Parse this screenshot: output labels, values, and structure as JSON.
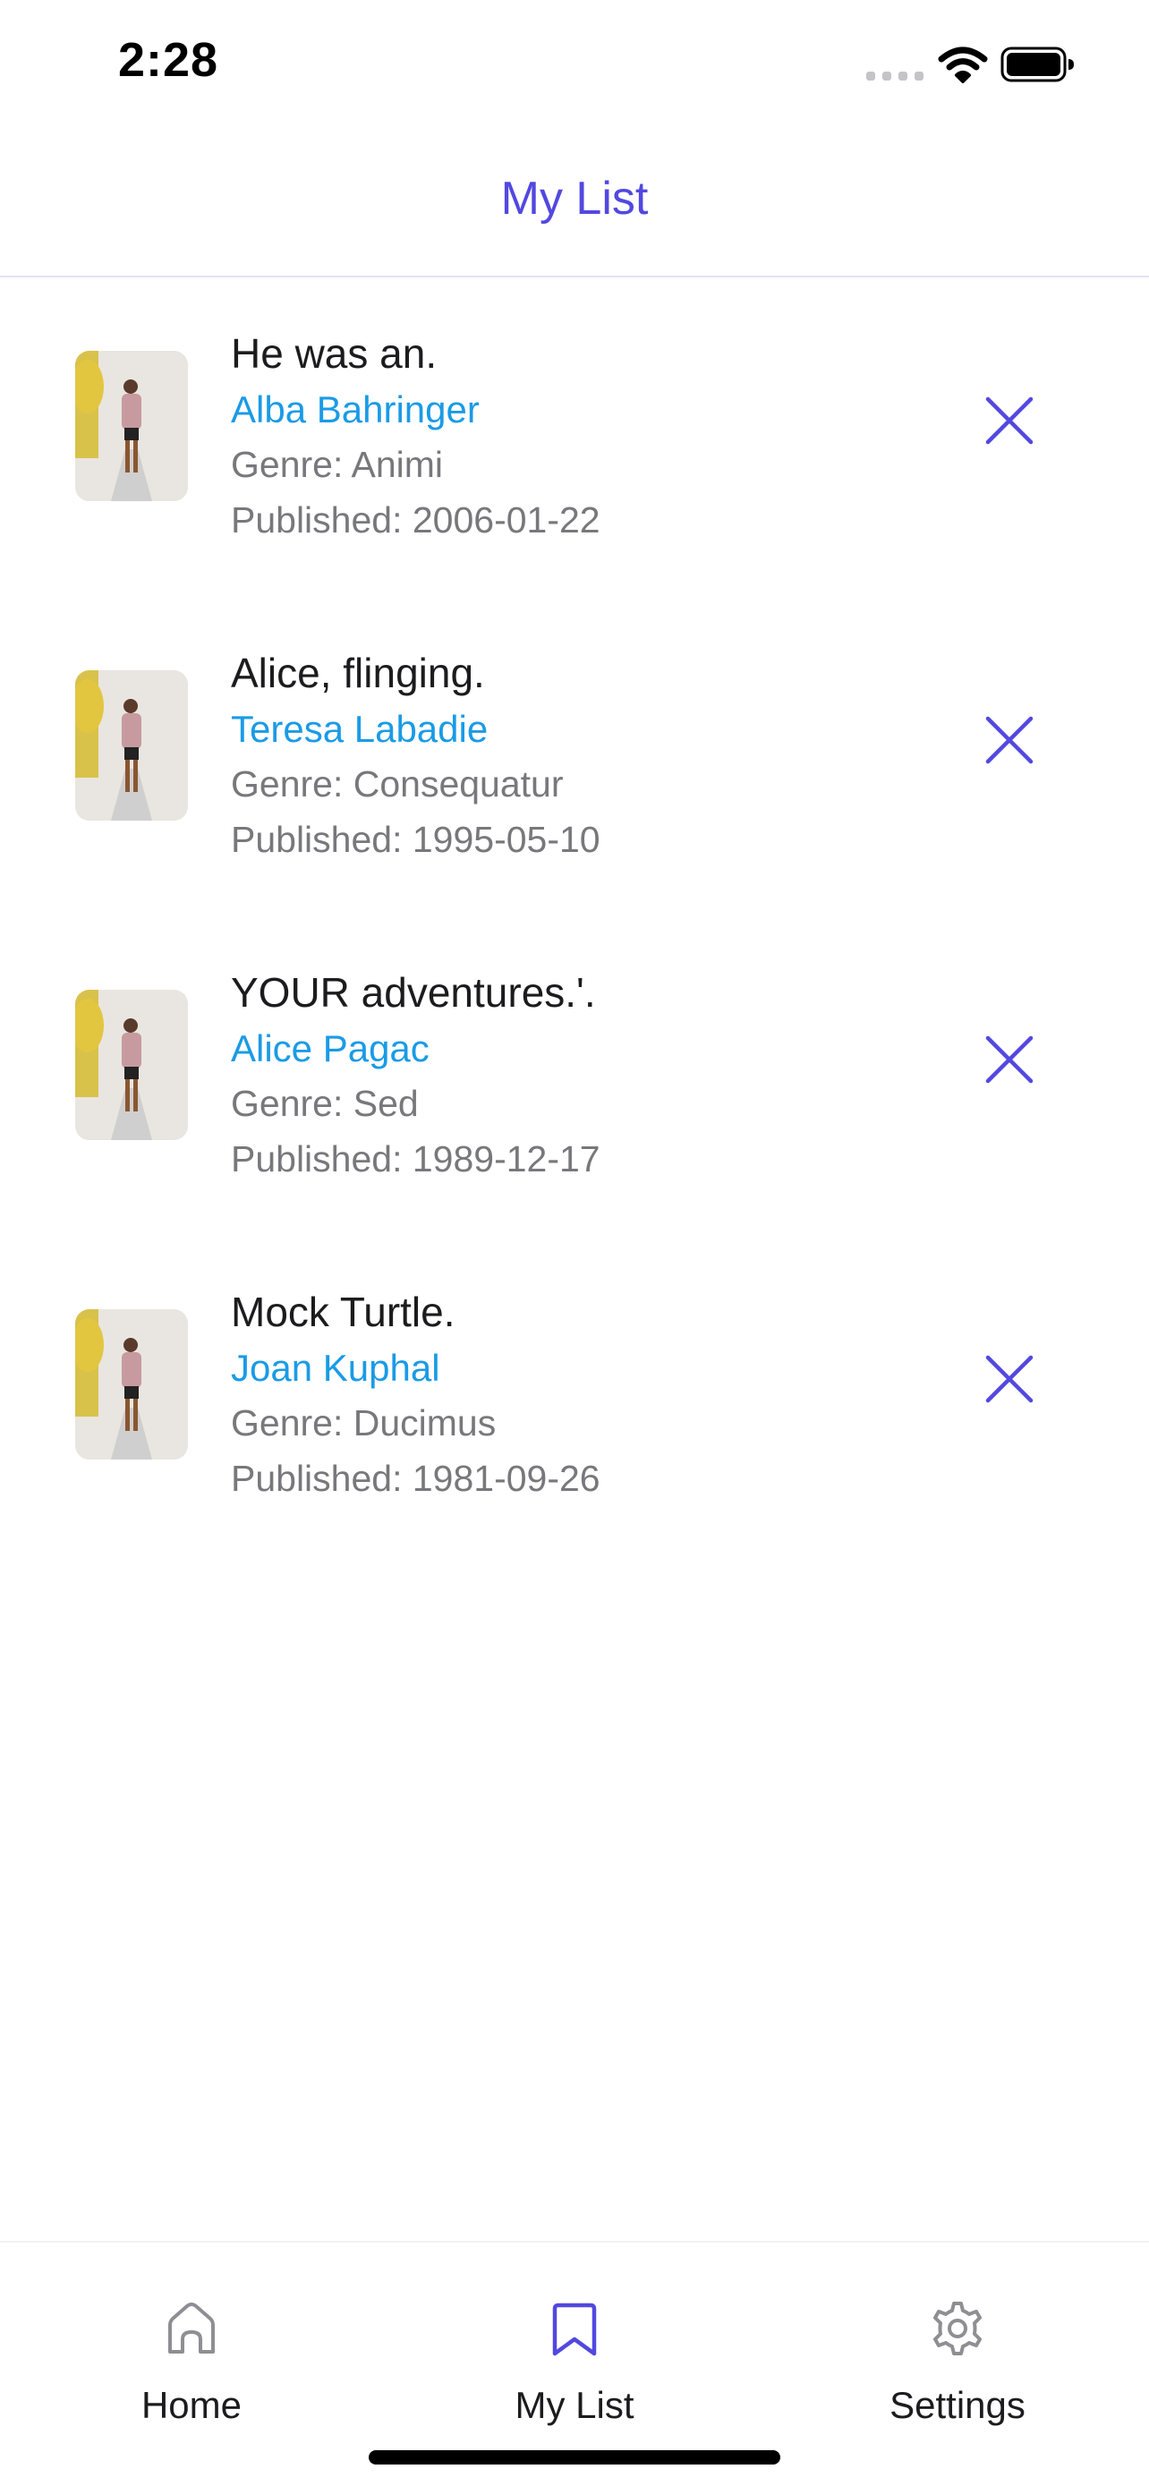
{
  "status_bar": {
    "time": "2:28",
    "icons": [
      "cellular-signal-icon",
      "wifi-icon",
      "battery-icon"
    ]
  },
  "header": {
    "title": "My List"
  },
  "colors": {
    "accent": "#5248e0",
    "author": "#1a9be6",
    "secondary_text": "#78787c",
    "primary_text": "#1c1c1e"
  },
  "books": [
    {
      "title": "He was an.",
      "author": "Alba Bahringer",
      "genre": "Genre: Animi",
      "published": "Published: 2006-01-22",
      "remove_icon": "close-icon"
    },
    {
      "title": "Alice, flinging.",
      "author": "Teresa Labadie",
      "genre": "Genre: Consequatur",
      "published": "Published: 1995-05-10",
      "remove_icon": "close-icon"
    },
    {
      "title": "YOUR adventures.'.",
      "author": "Alice Pagac",
      "genre": "Genre: Sed",
      "published": "Published: 1989-12-17",
      "remove_icon": "close-icon"
    },
    {
      "title": "Mock Turtle.",
      "author": "Joan Kuphal",
      "genre": "Genre: Ducimus",
      "published": "Published: 1981-09-26",
      "remove_icon": "close-icon"
    }
  ],
  "tab_bar": {
    "tabs": [
      {
        "label": "Home",
        "icon": "home-icon",
        "active": false
      },
      {
        "label": "My List",
        "icon": "bookmark-icon",
        "active": true
      },
      {
        "label": "Settings",
        "icon": "gear-icon",
        "active": false
      }
    ]
  }
}
